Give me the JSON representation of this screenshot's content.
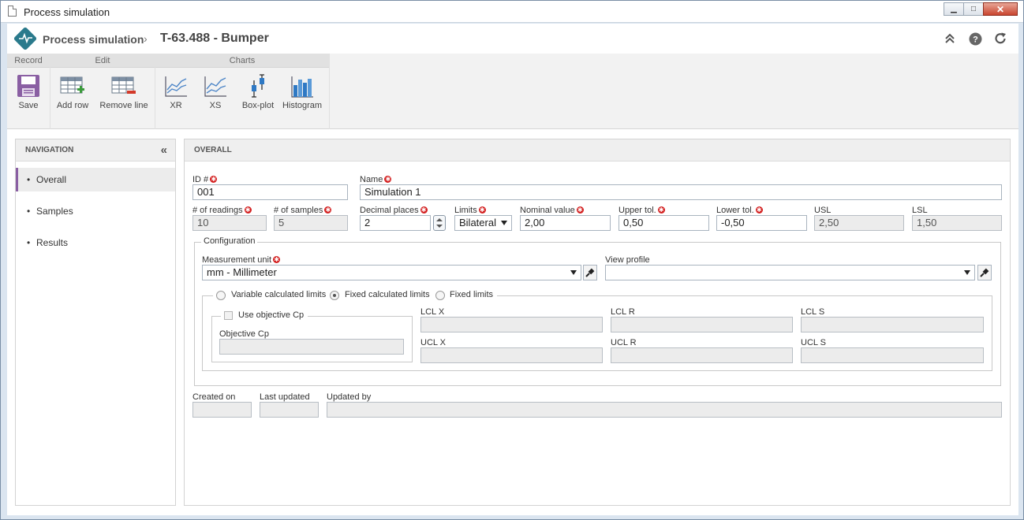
{
  "window": {
    "title": "Process simulation"
  },
  "header": {
    "app_name": "Process simulation",
    "separator": "›",
    "record_title": "T-63.488 - Bumper"
  },
  "toolbar": {
    "groups": [
      {
        "label": "Record",
        "buttons": [
          {
            "label": "Save",
            "icon": "save-icon"
          }
        ]
      },
      {
        "label": "Edit",
        "buttons": [
          {
            "label": "Add row",
            "icon": "add-row-icon"
          },
          {
            "label": "Remove line",
            "icon": "remove-line-icon"
          }
        ]
      },
      {
        "label": "Charts",
        "buttons": [
          {
            "label": "XR",
            "icon": "xr-chart-icon"
          },
          {
            "label": "XS",
            "icon": "xs-chart-icon"
          },
          {
            "label": "Box-plot",
            "icon": "box-plot-icon"
          },
          {
            "label": "Histogram",
            "icon": "histogram-icon"
          }
        ]
      }
    ]
  },
  "navigation": {
    "title": "NAVIGATION",
    "items": [
      {
        "label": "Overall",
        "active": true
      },
      {
        "label": "Samples",
        "active": false
      },
      {
        "label": "Results",
        "active": false
      }
    ]
  },
  "main": {
    "title": "OVERALL",
    "fields": {
      "id": {
        "label": "ID #",
        "value": "001"
      },
      "name": {
        "label": "Name",
        "value": "Simulation 1"
      },
      "readings": {
        "label": "# of readings",
        "value": "10"
      },
      "samples": {
        "label": "# of samples",
        "value": "5"
      },
      "decimal_places": {
        "label": "Decimal places",
        "value": "2"
      },
      "limits": {
        "label": "Limits",
        "value": "Bilateral"
      },
      "nominal": {
        "label": "Nominal value",
        "value": "2,00"
      },
      "upper_tol": {
        "label": "Upper tol.",
        "value": "0,50"
      },
      "lower_tol": {
        "label": "Lower tol.",
        "value": "-0,50"
      },
      "usl": {
        "label": "USL",
        "value": "2,50"
      },
      "lsl": {
        "label": "LSL",
        "value": "1,50"
      }
    },
    "configuration": {
      "legend": "Configuration",
      "measurement_unit": {
        "label": "Measurement unit",
        "value": "mm - Millimeter"
      },
      "view_profile": {
        "label": "View profile",
        "value": ""
      },
      "limit_options": [
        {
          "label": "Variable calculated limits",
          "selected": false
        },
        {
          "label": "Fixed calculated limits",
          "selected": true
        },
        {
          "label": "Fixed limits",
          "selected": false
        }
      ],
      "use_objective_cp": {
        "label": "Use objective Cp",
        "checked": false
      },
      "objective_cp": {
        "label": "Objective Cp",
        "value": ""
      },
      "limits": {
        "lcl_x": {
          "label": "LCL X",
          "value": ""
        },
        "lcl_r": {
          "label": "LCL R",
          "value": ""
        },
        "lcl_s": {
          "label": "LCL S",
          "value": ""
        },
        "ucl_x": {
          "label": "UCL X",
          "value": ""
        },
        "ucl_r": {
          "label": "UCL R",
          "value": ""
        },
        "ucl_s": {
          "label": "UCL S",
          "value": ""
        }
      }
    },
    "audit": {
      "created_on": {
        "label": "Created on",
        "value": ""
      },
      "last_updated": {
        "label": "Last updated",
        "value": ""
      },
      "updated_by": {
        "label": "Updated by",
        "value": ""
      }
    }
  },
  "colors": {
    "accent": "#8a5fa3",
    "logo": "#2a7a8c",
    "required": "#d31f1f"
  }
}
